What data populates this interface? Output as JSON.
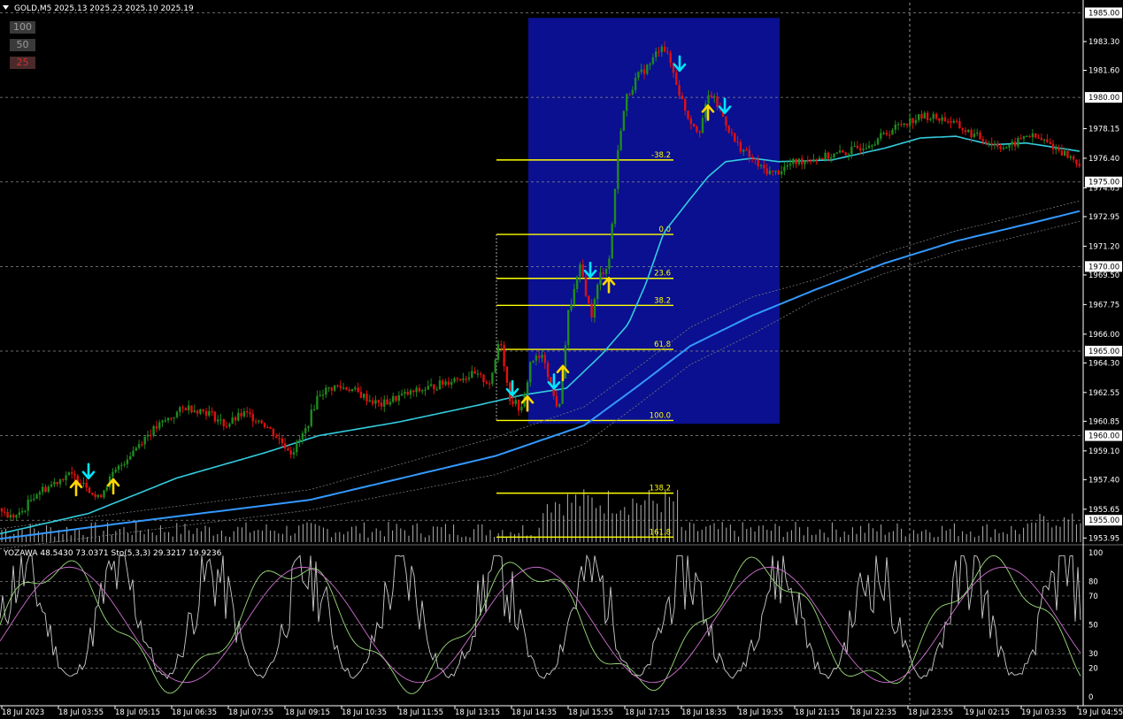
{
  "header": {
    "text": "GOLD,M5  2025.13 2025.23 2025.10 2025.19"
  },
  "level_buttons": [
    {
      "label": "100",
      "bg": "#3a3a3a",
      "fg": "#9a9a9a"
    },
    {
      "label": "50",
      "bg": "#3a3a3a",
      "fg": "#9a9a9a"
    },
    {
      "label": "25",
      "bg": "#4a2a2a",
      "fg": "#cc3333"
    }
  ],
  "indicator_label": "YOZAWA 48.5430 73.0371  Sto(5,3,3) 29.3217 19.9236",
  "colors": {
    "bull": "#1f8a1f",
    "bear": "#e01010",
    "ma_fast": "#33ccdd",
    "ma_slow": "#3399ff",
    "fib": "#ffff00",
    "box": "#0a108f",
    "stoch_main": "#9bdf7a",
    "stoch_signal": "#d070d0",
    "yozawa": "#cccccc",
    "arrow_up": "#ffd700",
    "arrow_down": "#00e5ff"
  },
  "chart_data": {
    "type": "candlestick",
    "symbol": "GOLD",
    "timeframe": "M5",
    "ylim": [
      1953.6,
      1985.6
    ],
    "price_ticks": [
      "1983.30",
      "1981.60",
      "1978.15",
      "1976.40",
      "1974.65",
      "1972.95",
      "1971.20",
      "1969.50",
      "1967.75",
      "1966.00",
      "1964.30",
      "1962.55",
      "1960.85",
      "1959.10",
      "1957.40",
      "1955.65",
      "1953.95"
    ],
    "boxed_levels": [
      "1985.00",
      "1980.00",
      "1975.00",
      "1970.00",
      "1965.00",
      "1960.00",
      "1955.00"
    ],
    "time_labels": [
      "18 Jul 2023",
      "18 Jul 03:55",
      "18 Jul 05:15",
      "18 Jul 06:35",
      "18 Jul 07:55",
      "18 Jul 09:15",
      "18 Jul 10:35",
      "18 Jul 11:55",
      "18 Jul 13:15",
      "18 Jul 14:35",
      "18 Jul 15:55",
      "18 Jul 17:15",
      "18 Jul 18:35",
      "18 Jul 19:55",
      "18 Jul 21:15",
      "18 Jul 22:35",
      "18 Jul 23:55",
      "19 Jul 02:15",
      "19 Jul 03:35",
      "19 Jul 04:55"
    ],
    "close_profile": [
      [
        0,
        1955.7
      ],
      [
        10,
        1955.2
      ],
      [
        22,
        1955.3
      ],
      [
        40,
        1956.6
      ],
      [
        55,
        1957.0
      ],
      [
        75,
        1957.7
      ],
      [
        95,
        1957.3
      ],
      [
        110,
        1956.2
      ],
      [
        125,
        1957.5
      ],
      [
        145,
        1958.8
      ],
      [
        165,
        1960.0
      ],
      [
        185,
        1960.8
      ],
      [
        210,
        1961.7
      ],
      [
        235,
        1961.4
      ],
      [
        255,
        1960.6
      ],
      [
        275,
        1961.3
      ],
      [
        295,
        1960.9
      ],
      [
        315,
        1959.8
      ],
      [
        330,
        1959.0
      ],
      [
        345,
        1960.3
      ],
      [
        360,
        1962.5
      ],
      [
        378,
        1962.9
      ],
      [
        395,
        1962.8
      ],
      [
        415,
        1962.2
      ],
      [
        430,
        1961.8
      ],
      [
        450,
        1962.3
      ],
      [
        470,
        1962.6
      ],
      [
        495,
        1963.0
      ],
      [
        515,
        1963.4
      ],
      [
        535,
        1963.6
      ],
      [
        555,
        1963.1
      ],
      [
        565,
        1966.0
      ],
      [
        575,
        1962.3
      ],
      [
        590,
        1961.5
      ],
      [
        600,
        1964.5
      ],
      [
        615,
        1964.6
      ],
      [
        625,
        1962.4
      ],
      [
        632,
        1961.5
      ],
      [
        642,
        1967.2
      ],
      [
        656,
        1970.0
      ],
      [
        668,
        1967.0
      ],
      [
        678,
        1969.5
      ],
      [
        688,
        1970.2
      ],
      [
        700,
        1977.8
      ],
      [
        708,
        1980.0
      ],
      [
        720,
        1981.2
      ],
      [
        735,
        1982.0
      ],
      [
        748,
        1983.2
      ],
      [
        758,
        1982.0
      ],
      [
        768,
        1980.2
      ],
      [
        778,
        1978.8
      ],
      [
        790,
        1978.0
      ],
      [
        802,
        1980.3
      ],
      [
        815,
        1979.1
      ],
      [
        830,
        1977.4
      ],
      [
        845,
        1976.6
      ],
      [
        860,
        1975.8
      ],
      [
        875,
        1975.5
      ],
      [
        895,
        1976.1
      ],
      [
        915,
        1976.4
      ],
      [
        935,
        1976.5
      ],
      [
        960,
        1976.8
      ],
      [
        990,
        1977.5
      ],
      [
        1020,
        1978.5
      ],
      [
        1045,
        1978.9
      ],
      [
        1070,
        1978.7
      ],
      [
        1095,
        1977.9
      ],
      [
        1120,
        1977.3
      ],
      [
        1140,
        1977.0
      ],
      [
        1160,
        1977.8
      ],
      [
        1180,
        1977.4
      ],
      [
        1200,
        1976.8
      ],
      [
        1222,
        1976.0
      ]
    ],
    "ma_fast_profile": [
      [
        0,
        1954.2
      ],
      [
        100,
        1955.4
      ],
      [
        200,
        1957.5
      ],
      [
        300,
        1959.0
      ],
      [
        360,
        1960.0
      ],
      [
        450,
        1960.8
      ],
      [
        540,
        1961.8
      ],
      [
        590,
        1962.4
      ],
      [
        640,
        1962.8
      ],
      [
        680,
        1964.8
      ],
      [
        710,
        1966.6
      ],
      [
        730,
        1969.0
      ],
      [
        750,
        1972.0
      ],
      [
        780,
        1974.0
      ],
      [
        800,
        1975.3
      ],
      [
        820,
        1976.2
      ],
      [
        850,
        1976.4
      ],
      [
        880,
        1976.2
      ],
      [
        940,
        1976.3
      ],
      [
        1000,
        1977.0
      ],
      [
        1040,
        1977.6
      ],
      [
        1080,
        1977.7
      ],
      [
        1120,
        1977.2
      ],
      [
        1160,
        1977.3
      ],
      [
        1222,
        1976.8
      ]
    ],
    "ma_slow_profile": [
      [
        0,
        1953.9
      ],
      [
        150,
        1954.9
      ],
      [
        350,
        1956.2
      ],
      [
        560,
        1958.8
      ],
      [
        660,
        1960.6
      ],
      [
        720,
        1962.9
      ],
      [
        780,
        1965.3
      ],
      [
        850,
        1967.1
      ],
      [
        920,
        1968.6
      ],
      [
        1000,
        1970.2
      ],
      [
        1080,
        1971.5
      ],
      [
        1160,
        1972.5
      ],
      [
        1222,
        1973.3
      ]
    ],
    "signal_arrows": [
      {
        "time": "18 Jul 03:55",
        "dir": "up",
        "price": 1956.9
      },
      {
        "time": "18 Jul 03:55",
        "dir": "down",
        "price": 1957.9
      },
      {
        "time": "18 Jul 03:55",
        "dir": "up",
        "price": 1957.0
      },
      {
        "time": "18 Jul 14:35",
        "dir": "down",
        "price": 1962.8
      },
      {
        "time": "18 Jul 14:35",
        "dir": "up",
        "price": 1961.9
      },
      {
        "time": "18 Jul 14:35",
        "dir": "down",
        "price": 1963.2
      },
      {
        "time": "18 Jul 14:35",
        "dir": "up",
        "price": 1963.7
      },
      {
        "time": "18 Jul 15:55",
        "dir": "down",
        "price": 1969.8
      },
      {
        "time": "18 Jul 15:55",
        "dir": "up",
        "price": 1968.9
      },
      {
        "time": "18 Jul 17:15",
        "dir": "down",
        "price": 1982.0
      },
      {
        "time": "18 Jul 18:35",
        "dir": "up",
        "price": 1979.1
      },
      {
        "time": "18 Jul 18:35",
        "dir": "down",
        "price": 1979.5
      }
    ],
    "fibonacci": {
      "levels": [
        {
          "label": "-38.2",
          "price": 1976.3
        },
        {
          "label": "0.0",
          "price": 1971.9
        },
        {
          "label": "23.6",
          "price": 1969.3
        },
        {
          "label": "38.2",
          "price": 1967.7
        },
        {
          "label": "61.8",
          "price": 1965.1
        },
        {
          "label": "100.0",
          "price": 1960.9
        },
        {
          "label": "138.2",
          "price": 1956.6
        },
        {
          "label": "161.8",
          "price": 1954.0
        }
      ]
    },
    "highlight_box": {
      "price_top": 1984.7,
      "price_bottom": 1960.7,
      "time_from": "18 Jul 14:35",
      "time_to": "18 Jul 19:55"
    },
    "oscillator": {
      "ylim": [
        0,
        100
      ],
      "ticks": [
        "100",
        "80",
        "70",
        "50",
        "30",
        "20",
        "0"
      ],
      "stoch_main_latest": 29.3217,
      "stoch_signal_latest": 19.9236,
      "yozawa": [
        48.543,
        73.0371
      ]
    }
  }
}
